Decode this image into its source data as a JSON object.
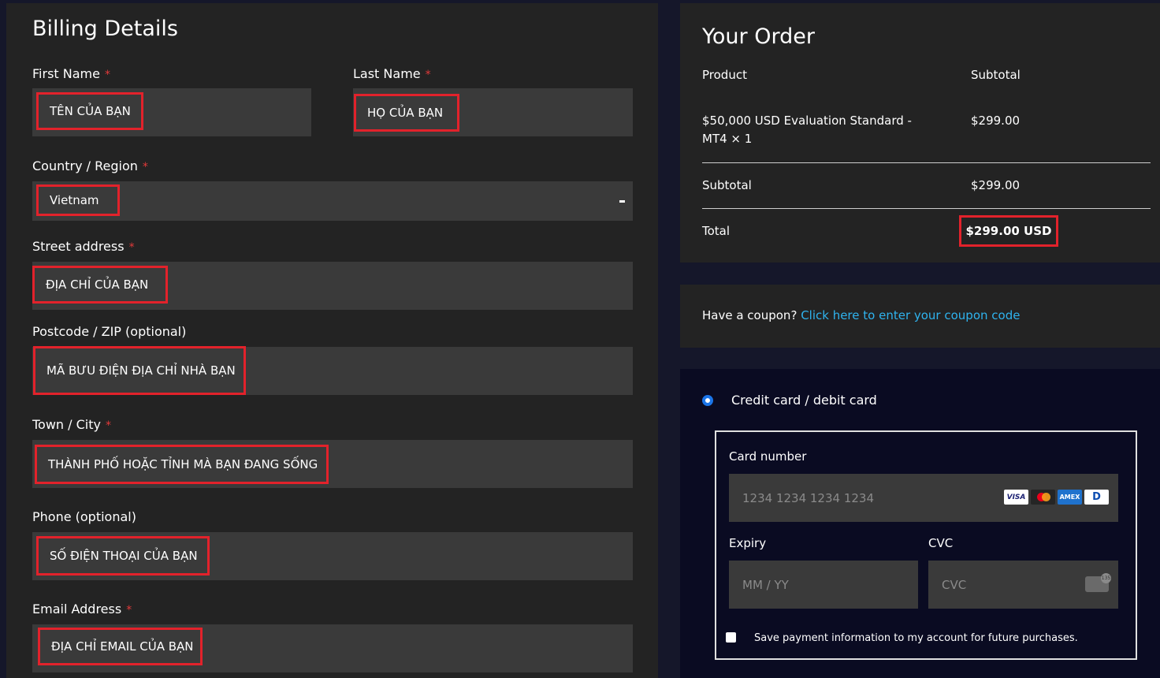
{
  "billing": {
    "title": "Billing Details",
    "first_name": {
      "label": "First Name",
      "required": "*",
      "value": "TÊN CỦA BẠN"
    },
    "last_name": {
      "label": "Last Name",
      "required": "*",
      "value": "HỌ CỦA BẠN"
    },
    "country": {
      "label": "Country / Region",
      "required": "*",
      "value": "Vietnam"
    },
    "street": {
      "label": "Street address",
      "required": "*",
      "value": "ĐỊA CHỈ CỦA BẠN"
    },
    "postcode": {
      "label": "Postcode / ZIP (optional)",
      "value": "MÃ BƯU ĐIỆN ĐỊA CHỈ NHÀ BẠN"
    },
    "city": {
      "label": "Town / City",
      "required": "*",
      "value": "THÀNH PHỐ HOẶC TỈNH MÀ BẠN ĐANG SỐNG"
    },
    "phone": {
      "label": "Phone (optional)",
      "value": "SỐ ĐIỆN THOẠI CỦA BẠN"
    },
    "email": {
      "label": "Email Address",
      "required": "*",
      "value": "ĐỊA CHỈ EMAIL CỦA BẠN"
    }
  },
  "order": {
    "title": "Your Order",
    "col_product": "Product",
    "col_subtotal": "Subtotal",
    "item_line1": "$50,000 USD Evaluation Standard -",
    "item_line2": "MT4  × 1",
    "item_price": "$299.00",
    "subtotal_label": "Subtotal",
    "subtotal_value": "$299.00",
    "total_label": "Total",
    "total_value": "$299.00 USD"
  },
  "coupon": {
    "prompt": "Have a coupon?",
    "link": "Click here to enter your coupon code"
  },
  "payment": {
    "method_label": "Credit card / debit card",
    "card_number_label": "Card number",
    "card_number_placeholder": "1234 1234 1234 1234",
    "expiry_label": "Expiry",
    "expiry_placeholder": "MM / YY",
    "cvc_label": "CVC",
    "cvc_placeholder": "CVC",
    "cvc_badge": "135",
    "save_label": "Save payment information to my account for future purchases.",
    "brands": [
      "VISA",
      "mastercard",
      "AMEX",
      "D"
    ]
  },
  "colors": {
    "accent_link": "#2fb3ee",
    "highlight": "#e2222b",
    "required": "#e23a3a",
    "panel": "#232323",
    "input": "#3a3a3a"
  }
}
